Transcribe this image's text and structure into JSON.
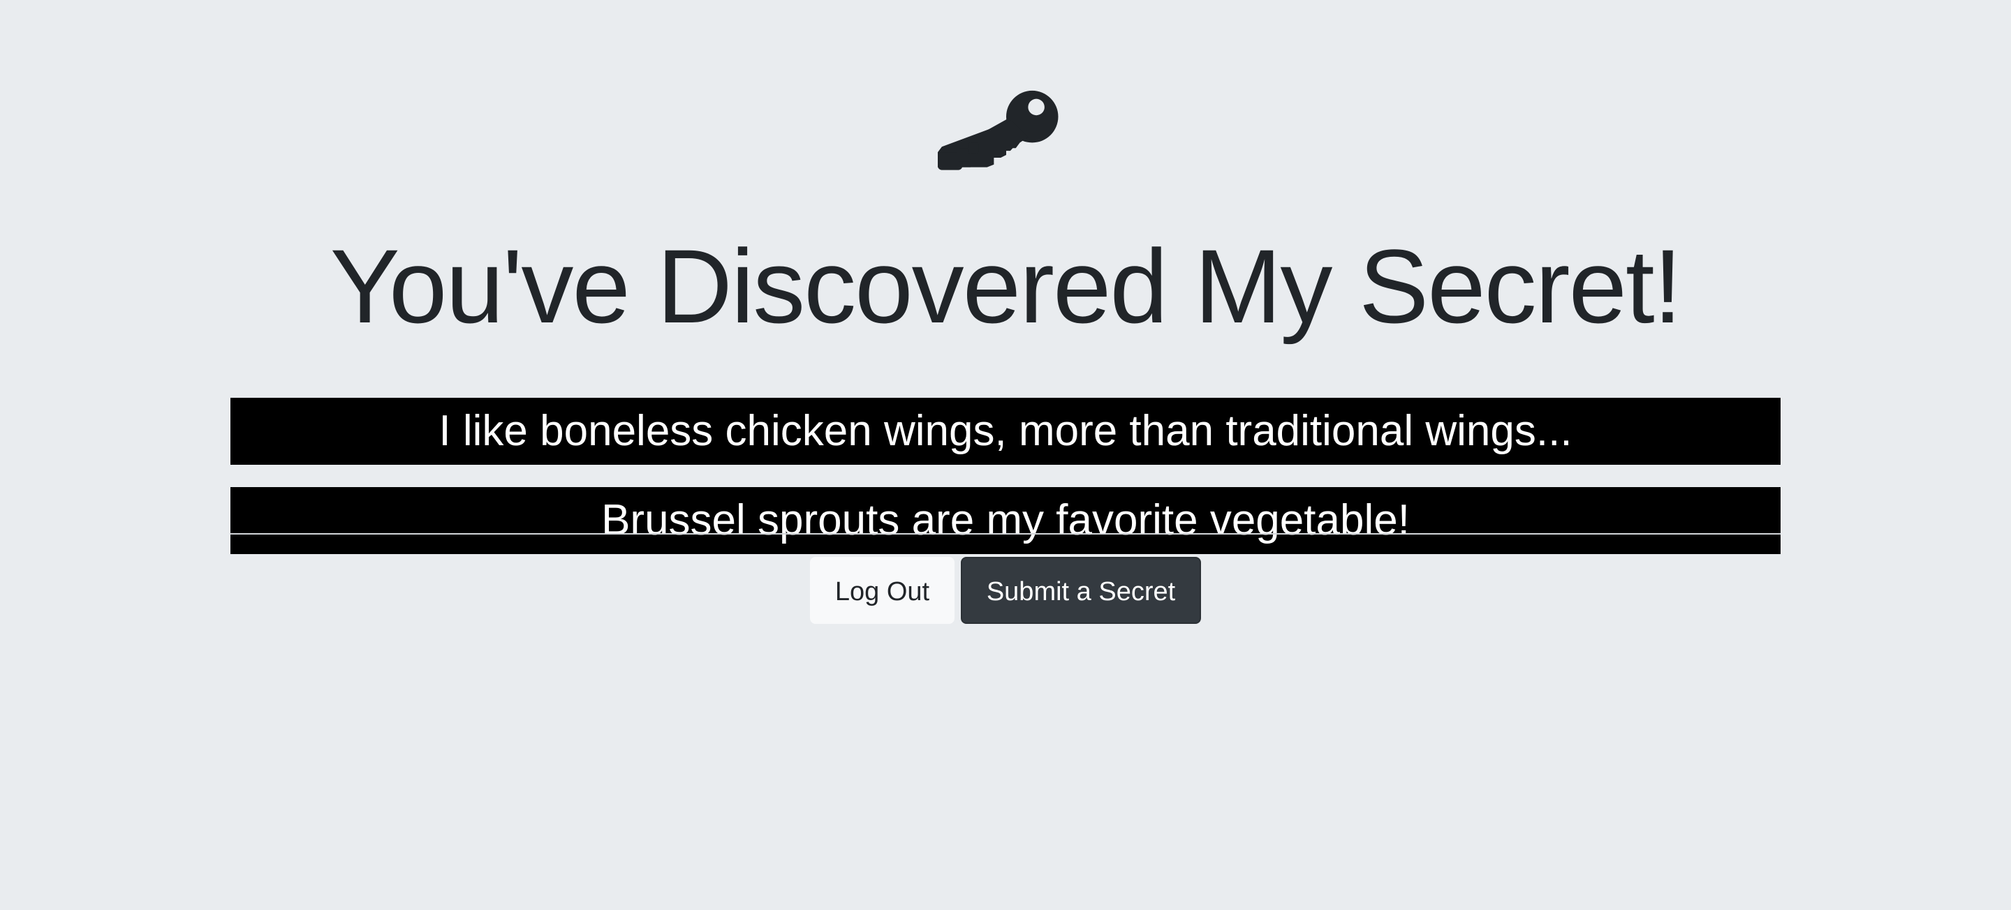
{
  "icon": "key-icon",
  "title": "You've Discovered My Secret!",
  "secrets": [
    "I like boneless chicken wings, more than traditional wings...",
    "Brussel sprouts are my favorite vegetable!"
  ],
  "buttons": {
    "logout_label": "Log Out",
    "submit_label": "Submit a Secret"
  },
  "colors": {
    "background": "#e9ecef",
    "text": "#212529",
    "secret_background": "#000000",
    "secret_text": "#ffffff",
    "dark_button": "#343a40",
    "light_button": "#f8f9fa"
  }
}
